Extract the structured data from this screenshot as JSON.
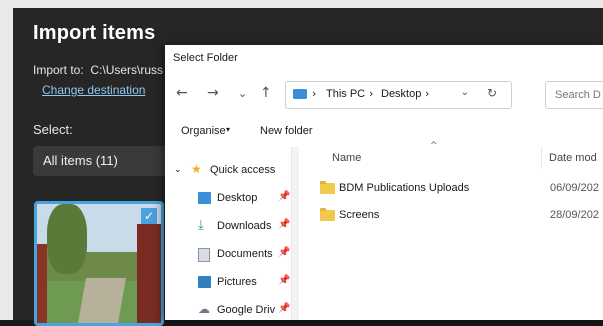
{
  "import_panel": {
    "title": "Import items",
    "import_to_label": "Import to:",
    "import_to_path": "C:\\Users\\russ",
    "change_destination": "Change destination",
    "select_label": "Select:",
    "select_value": "All items (11)",
    "thumbnail_selected_mark": "✓"
  },
  "dialog": {
    "title": "Select Folder",
    "nav": {
      "back": "←",
      "forward": "→",
      "recent": "⌄",
      "up": "↑"
    },
    "address": {
      "crumbs": [
        "This PC",
        "Desktop"
      ],
      "separator": "›",
      "dropdown": "⌄",
      "refresh": "↻"
    },
    "search_placeholder": "Search D",
    "toolbar": {
      "organise": "Organise",
      "organise_caret": "▾",
      "new_folder": "New folder"
    },
    "nav_pane": {
      "expander": "⌄",
      "quick_access": "Quick access",
      "items": [
        {
          "label": "Desktop",
          "icon": "desktop-icon",
          "pin": "📌"
        },
        {
          "label": "Downloads",
          "icon": "download-icon",
          "pin": "📌"
        },
        {
          "label": "Documents",
          "icon": "document-icon",
          "pin": "📌"
        },
        {
          "label": "Pictures",
          "icon": "pictures-icon",
          "pin": "📌"
        },
        {
          "label": "Google Drive",
          "icon": "cloud-icon",
          "pin": "📌"
        }
      ]
    },
    "columns": {
      "sort_arrow": "^",
      "name": "Name",
      "date": "Date mod"
    },
    "files": [
      {
        "name": "BDM Publications Uploads",
        "date": "06/09/202"
      },
      {
        "name": "Screens",
        "date": "28/09/202"
      }
    ]
  },
  "colors": {
    "accent": "#4aa3df",
    "link": "#8fc8f0",
    "folder": "#f2c94c",
    "panel_bg": "#262626"
  }
}
